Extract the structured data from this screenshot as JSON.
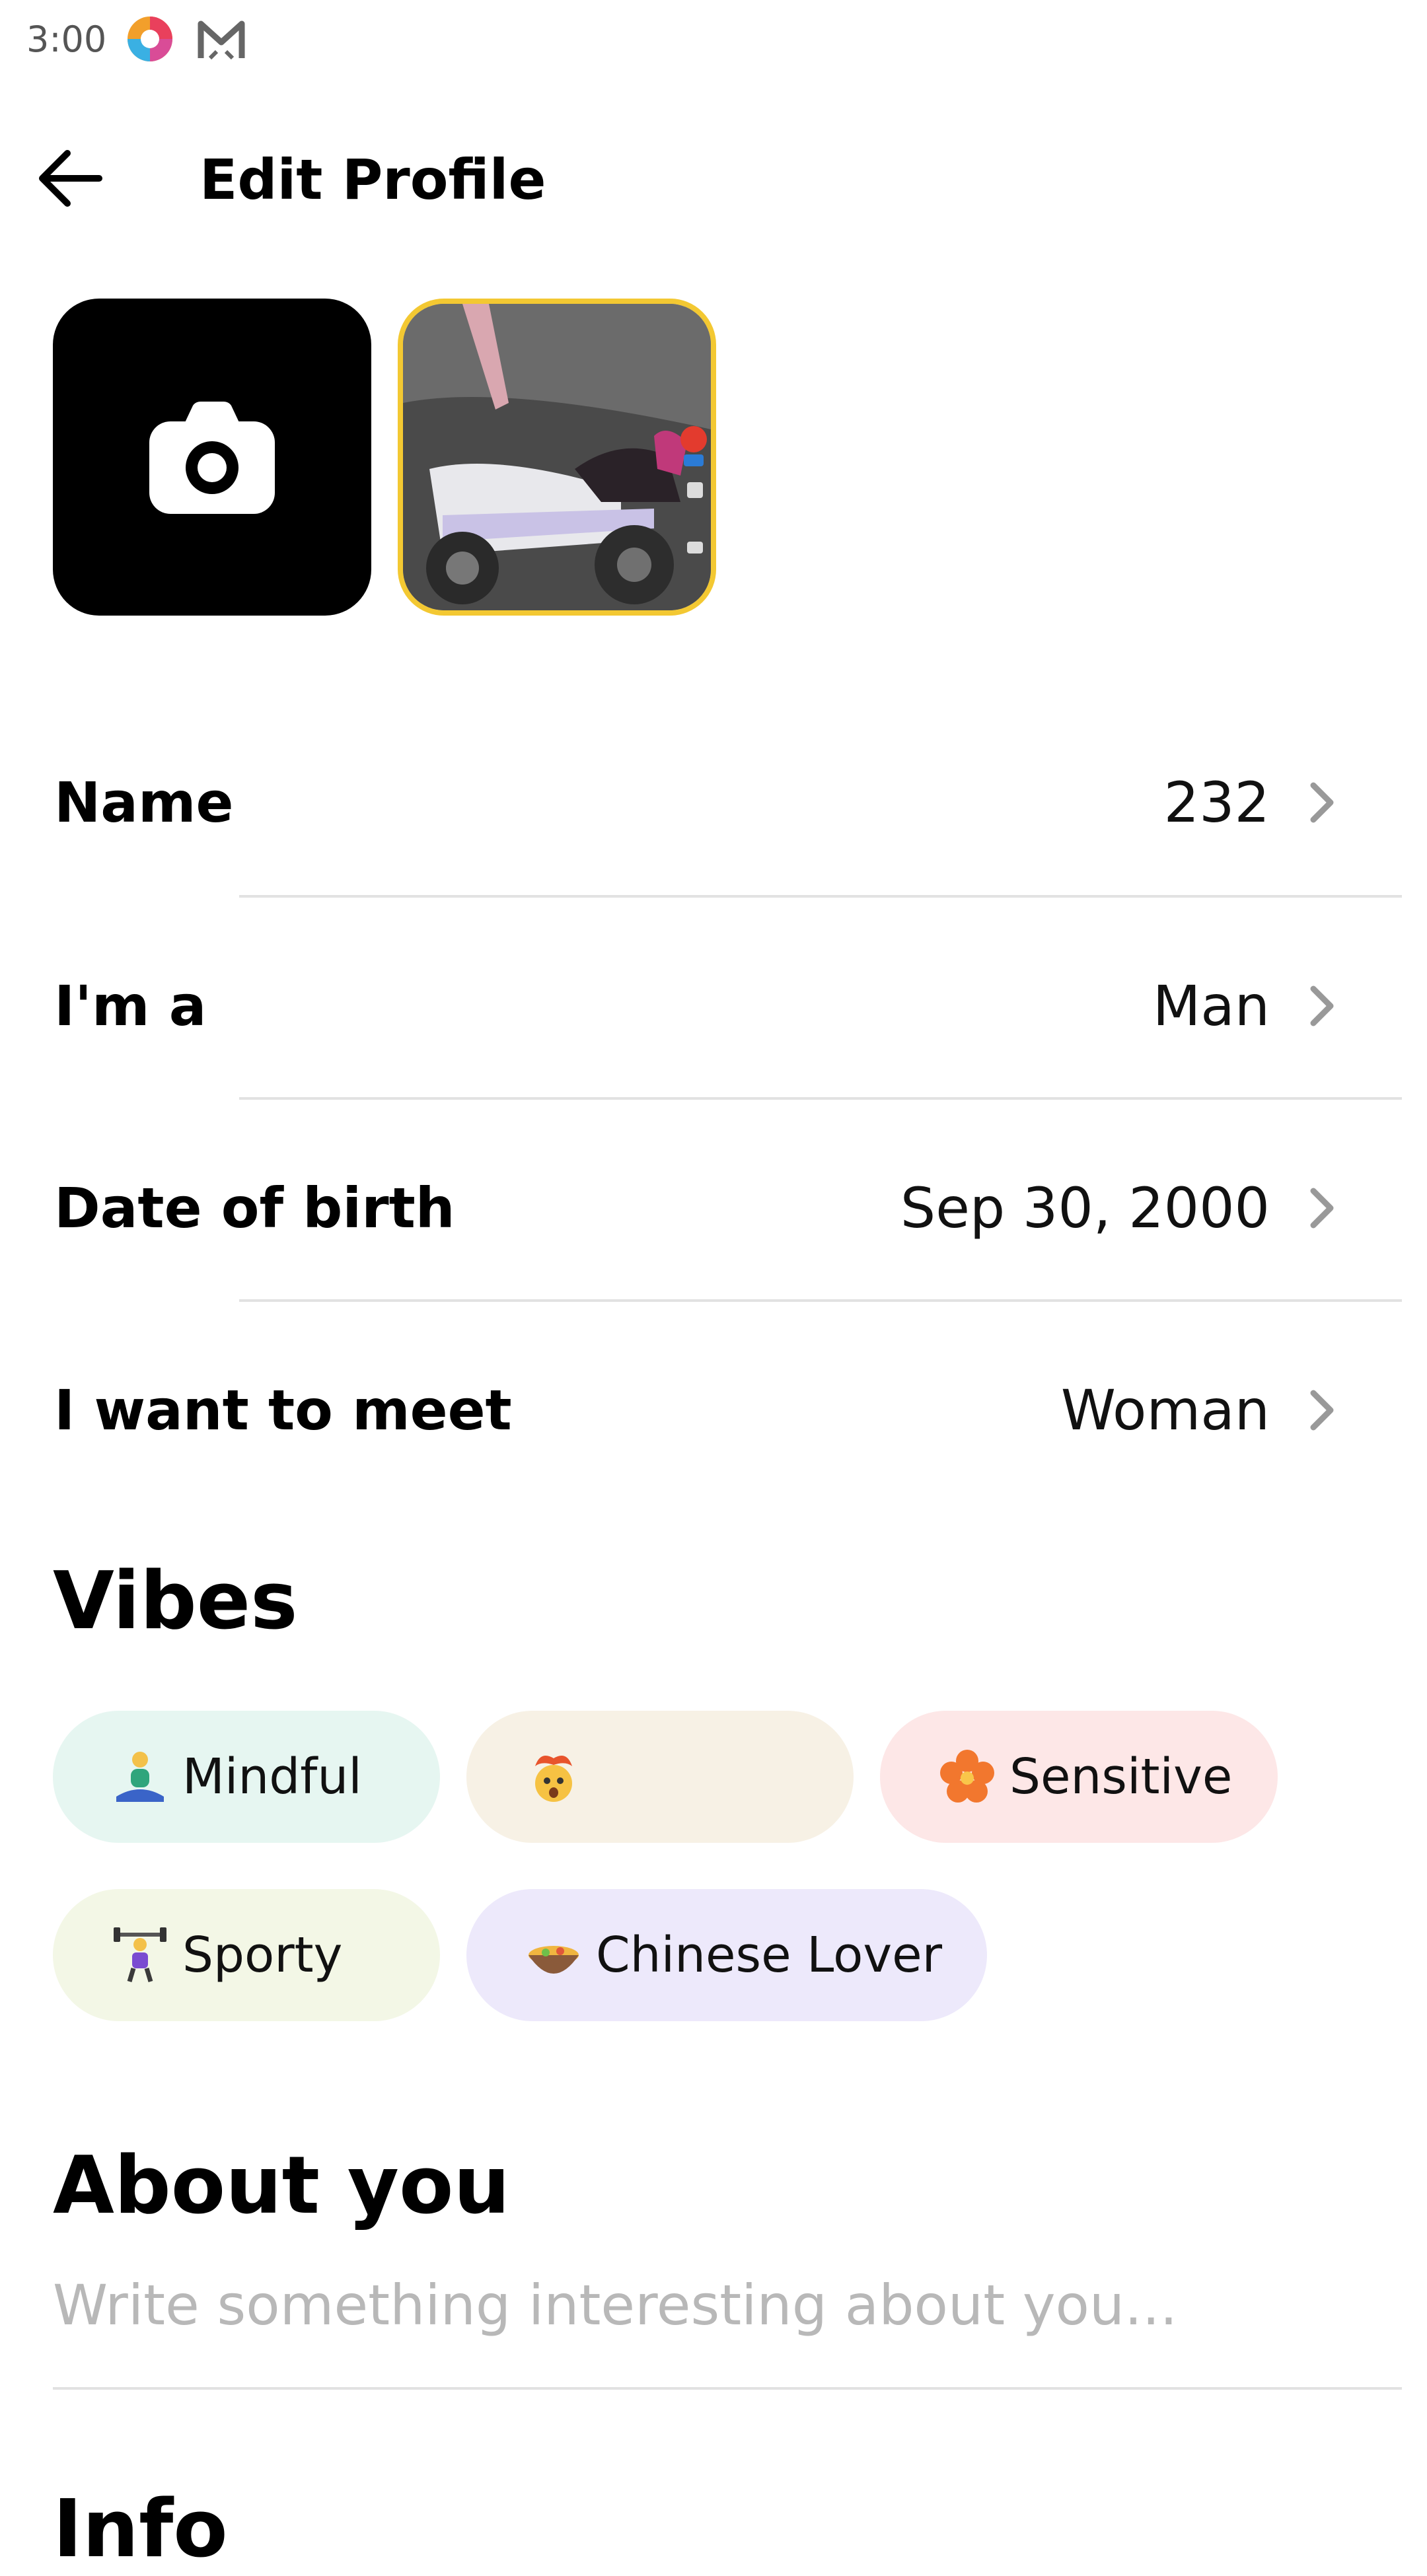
{
  "status_bar": {
    "time": "3:00",
    "icons": [
      "color-wheel-app-icon",
      "mail-app-icon"
    ]
  },
  "header": {
    "title": "Edit Profile",
    "back_icon": "arrow-left-icon"
  },
  "photos": {
    "add_icon": "camera-icon",
    "thumbnail_description_icon": "photo-thumbnail"
  },
  "fields": {
    "name": {
      "label": "Name",
      "value": "232"
    },
    "gender": {
      "label": "I'm a",
      "value": "Man"
    },
    "birth": {
      "label": "Date of birth",
      "value": "Sep 30, 2000"
    },
    "meet": {
      "label": "I want to meet",
      "value": "Woman"
    }
  },
  "vibes": {
    "title": "Vibes",
    "chips": [
      {
        "emoji_icon": "person-meditating-icon",
        "label": "Mindful",
        "bg": "#e6f6f1"
      },
      {
        "emoji_icon": "exploding-head-icon",
        "label": "",
        "bg": "#f7f1e5"
      },
      {
        "emoji_icon": "hibiscus-icon",
        "label": "Sensitive",
        "bg": "#fde7e7"
      },
      {
        "emoji_icon": "weightlifter-icon",
        "label": "Sporty",
        "bg": "#f3f7e6"
      },
      {
        "emoji_icon": "bowl-icon",
        "label": "Chinese Lover",
        "bg": "#ede9fb"
      }
    ]
  },
  "about": {
    "title": "About you",
    "placeholder": "Write something interesting about you..."
  },
  "next_section": {
    "title": "Info"
  },
  "colors": {
    "thumbnail_border": "#f3c832",
    "divider": "#e2e2e2",
    "placeholder": "#b8b8b8"
  }
}
